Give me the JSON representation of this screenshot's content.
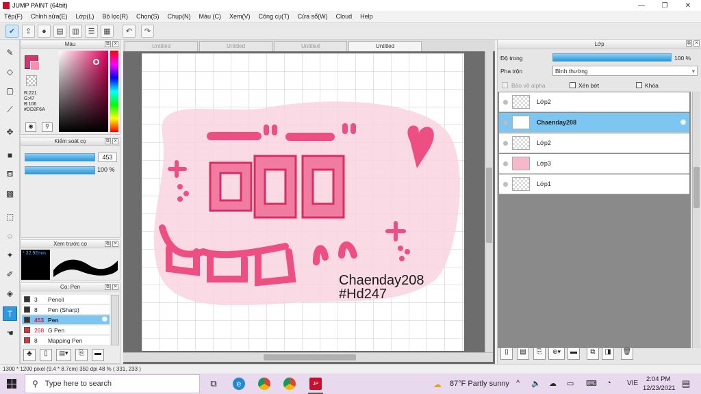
{
  "window": {
    "title": "JUMP PAINT (64bit)",
    "minimize": "—",
    "maximize": "❐",
    "close": "✕"
  },
  "menu": [
    "Tệp(F)",
    "Chỉnh sửa(E)",
    "Lớp(L)",
    "Bộ lọc(R)",
    "Chọn(S)",
    "Chụp(N)",
    "Màu (C)",
    "Xem(V)",
    "Công cụ(T)",
    "Cửa sổ(W)",
    "Cloud",
    "Help"
  ],
  "tabs": [
    "Untitled",
    "Untitled",
    "Untitled",
    "Untitled"
  ],
  "color_panel": {
    "title": "Màu",
    "r": "R:221",
    "g": "G:47",
    "b": "B:106",
    "hex": "#DD2F6A",
    "main_color": "#DD2F6A",
    "sub_color": "#F98FAE"
  },
  "brush_control": {
    "title": "Kiểm soát cọ",
    "size": "453",
    "opacity": "100 %"
  },
  "preview": {
    "title": "Xem trước cọ",
    "size": "32.92mm"
  },
  "brush_panel": {
    "title": "Cọ: Pen",
    "items": [
      {
        "size": "3",
        "name": "Pencil",
        "color": "#333333"
      },
      {
        "size": "8",
        "name": "Pen (Sharp)",
        "color": "#333333"
      },
      {
        "size": "453",
        "name": "Pen",
        "color": "#333333"
      },
      {
        "size": "268",
        "name": "G Pen",
        "color": "#e0333a"
      },
      {
        "size": "8",
        "name": "Mapping Pen",
        "color": "#e0333a"
      }
    ]
  },
  "artwork": {
    "line1": "Chaenday208",
    "line2": "#Hd247"
  },
  "layer_panel": {
    "title": "Lớp",
    "opacity_label": "Độ trong",
    "opacity_value": "100 %",
    "blend_label": "Pha trộn",
    "blend_value": "Bình thường",
    "protect_alpha": "Bảo vệ alpha",
    "clipping": "Xén bớt",
    "lock": "Khóa",
    "layers": [
      {
        "name": "Lớp2"
      },
      {
        "name": "Chaenday208"
      },
      {
        "name": "Lớp2"
      },
      {
        "name": "Lớp3"
      },
      {
        "name": "Lớp1"
      }
    ]
  },
  "status": "1300 * 1200 pixel   (9.4 * 8.7cm)   350 dpi   48 %   ( 331, 233 )",
  "taskbar": {
    "search_placeholder": "Type here to search",
    "weather": "87°F  Partly sunny",
    "lang": "VIE",
    "time": "2:04 PM",
    "date": "12/23/2021"
  }
}
